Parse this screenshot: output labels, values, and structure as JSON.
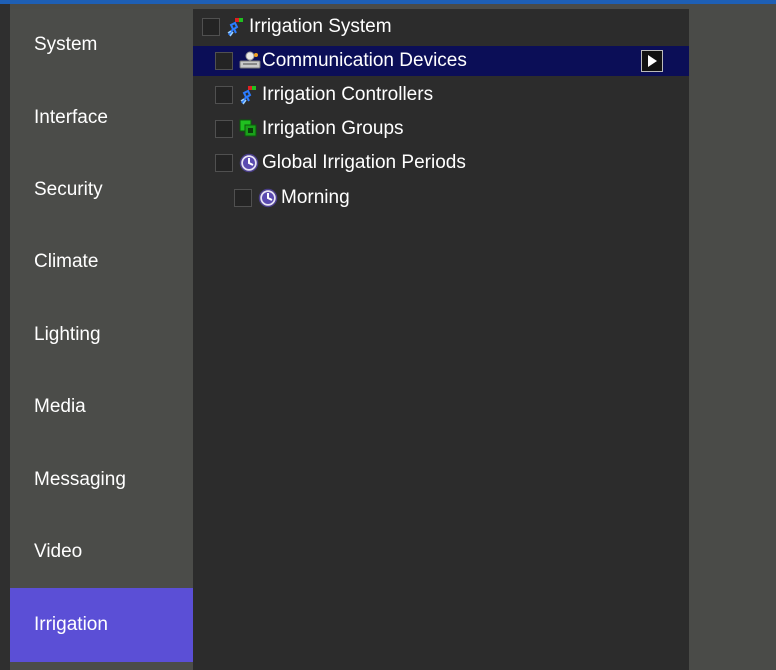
{
  "sidebar": {
    "items": [
      {
        "label": "System"
      },
      {
        "label": "Interface"
      },
      {
        "label": "Security"
      },
      {
        "label": "Climate"
      },
      {
        "label": "Lighting"
      },
      {
        "label": "Media"
      },
      {
        "label": "Messaging"
      },
      {
        "label": "Video"
      },
      {
        "label": "Irrigation",
        "active": true
      }
    ]
  },
  "tree": {
    "root": {
      "label": "Irrigation System",
      "icon": "irrigation-icon"
    },
    "children": [
      {
        "label": "Communication Devices",
        "icon": "communication-device-icon",
        "selected": true
      },
      {
        "label": "Irrigation Controllers",
        "icon": "irrigation-icon"
      },
      {
        "label": "Irrigation Groups",
        "icon": "group-icon"
      },
      {
        "label": "Global Irrigation Periods",
        "icon": "clock-icon"
      }
    ],
    "grandchildren": [
      {
        "label": "Morning",
        "icon": "clock-icon"
      }
    ]
  },
  "colors": {
    "accent_active": "#5b4fd6",
    "selection": "#0b0e57",
    "top_border": "#1e5fb5"
  }
}
